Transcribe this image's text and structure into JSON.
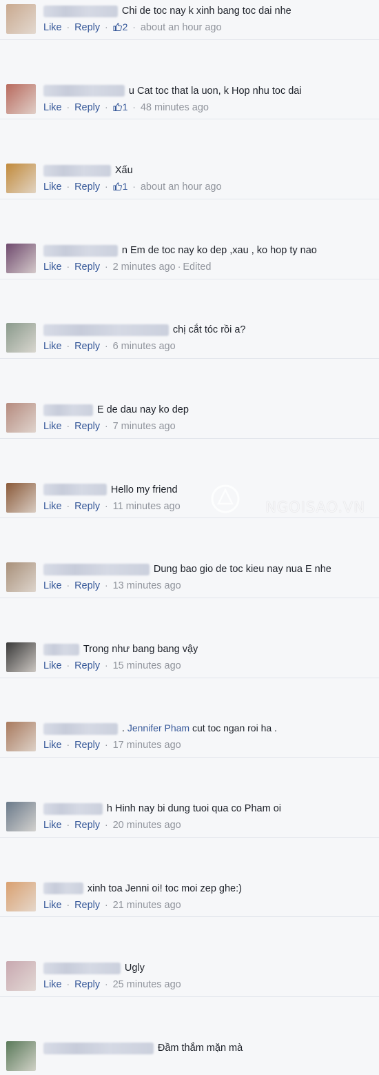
{
  "actions": {
    "like": "Like",
    "reply": "Reply",
    "separator": "·"
  },
  "watermark": "NGOISAO.VN",
  "comments": [
    {
      "text": "Chi de toc nay k xinh bang toc dai nhe",
      "likes": "2",
      "time": "about an hour ago",
      "avatar": "#c9a98f",
      "name_w": 108
    },
    {
      "text": "u Cat toc that la uon, k Hop nhu toc dai",
      "likes": "1",
      "time": "48 minutes ago",
      "avatar": "#b86a5e",
      "name_w": 118
    },
    {
      "text": "Xấu",
      "likes": "1",
      "time": "about an hour ago",
      "avatar": "#c18a3c",
      "name_w": 98
    },
    {
      "text": "n Em de toc nay ko dep ,xau , ko hop ty nao",
      "time": "2 minutes ago",
      "edited": "Edited",
      "avatar": "#6f4a6e",
      "name_w": 108
    },
    {
      "text": "chị cắt tóc rồi a?",
      "time": "6 minutes ago",
      "avatar": "#8a9a8c",
      "name_w": 182
    },
    {
      "text": "E de dau nay ko dep",
      "time": "7 minutes ago",
      "avatar": "#b58b7f",
      "name_w": 72
    },
    {
      "text": "Hello my friend",
      "time": "11 minutes ago",
      "avatar": "#8a5a3a",
      "name_w": 92
    },
    {
      "text": "Dung bao gio de toc kieu nay nua E nhe",
      "time": "13 minutes ago",
      "avatar": "#a8907a",
      "name_w": 154
    },
    {
      "text": "Trong như bang bang vậy",
      "time": "15 minutes ago",
      "avatar": "#3a3a3a",
      "name_w": 52
    },
    {
      "text": ".",
      "mention": "Jennifer Pham",
      "text_after": " cut toc ngan roi ha .",
      "time": "17 minutes ago",
      "avatar": "#a87a5e",
      "name_w": 108
    },
    {
      "text": "h Hinh nay bi dung tuoi qua co Pham oi",
      "time": "20 minutes ago",
      "avatar": "#6a7a8a",
      "name_w": 86
    },
    {
      "text": "xinh toa Jenni oi! toc moi zep ghe:)",
      "time": "21 minutes ago",
      "avatar": "#d9a070",
      "name_w": 58
    },
    {
      "text": "Ugly",
      "time": "25 minutes ago",
      "avatar": "#c8a8b0",
      "name_w": 112
    },
    {
      "text": "Đầm thắm mặn mà",
      "time": "",
      "avatar": "#5a7a5a",
      "name_w": 160
    }
  ]
}
